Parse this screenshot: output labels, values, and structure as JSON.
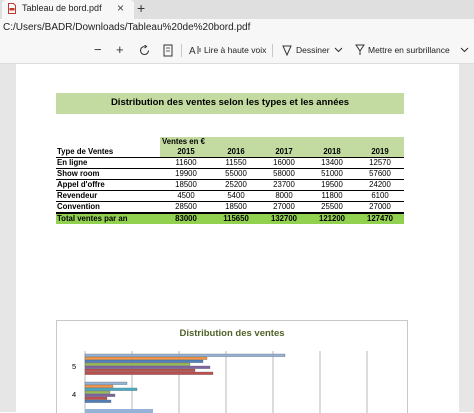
{
  "browser": {
    "tab_title": "Tableau de bord.pdf",
    "close_glyph": "×",
    "new_tab_glyph": "+",
    "address": "C:/Users/BADR/Downloads/Tableau%20de%20bord.pdf"
  },
  "toolbar": {
    "zoom_out": "−",
    "zoom_in": "+",
    "read_aloud_label": "Lire à haute voix",
    "draw_label": "Dessiner",
    "highlight_label": "Mettre en surbrillance",
    "icons": [
      "zoom-out-icon",
      "zoom-in-icon",
      "rotate-icon",
      "fit-page-icon",
      "read-aloud-icon",
      "draw-icon",
      "chevron-down-icon",
      "highlight-icon",
      "chevron-down-icon"
    ]
  },
  "document": {
    "title": "Distribution des ventes selon les types et les années",
    "table": {
      "unit_header": "Ventes en €",
      "row_header": "Type de Ventes",
      "years": [
        "2015",
        "2016",
        "2017",
        "2018",
        "2019"
      ],
      "rows": [
        {
          "label": "En ligne",
          "values": [
            "11600",
            "11550",
            "16000",
            "13400",
            "12570"
          ]
        },
        {
          "label": "Show room",
          "values": [
            "19900",
            "55000",
            "58000",
            "51000",
            "57600"
          ]
        },
        {
          "label": "Appel d'offre",
          "values": [
            "18500",
            "25200",
            "23700",
            "19500",
            "24200"
          ]
        },
        {
          "label": "Revendeur",
          "values": [
            "4500",
            "5400",
            "8000",
            "11800",
            "6100"
          ]
        },
        {
          "label": "Convention",
          "values": [
            "28500",
            "18500",
            "27000",
            "25500",
            "27000"
          ]
        }
      ],
      "total": {
        "label": "Total ventes par an",
        "values": [
          "83000",
          "115650",
          "132700",
          "121200",
          "127470"
        ]
      }
    }
  },
  "chart_data": {
    "type": "bar",
    "orientation": "horizontal",
    "title": "Distribution des ventes",
    "visible_categories": [
      "5",
      "4"
    ],
    "colors": [
      "#4f81bd",
      "#c0504d",
      "#9bbb59",
      "#8064a2",
      "#4bacc6",
      "#f79646",
      "#95b3d7"
    ],
    "note_colors": "series colors only"
  }
}
